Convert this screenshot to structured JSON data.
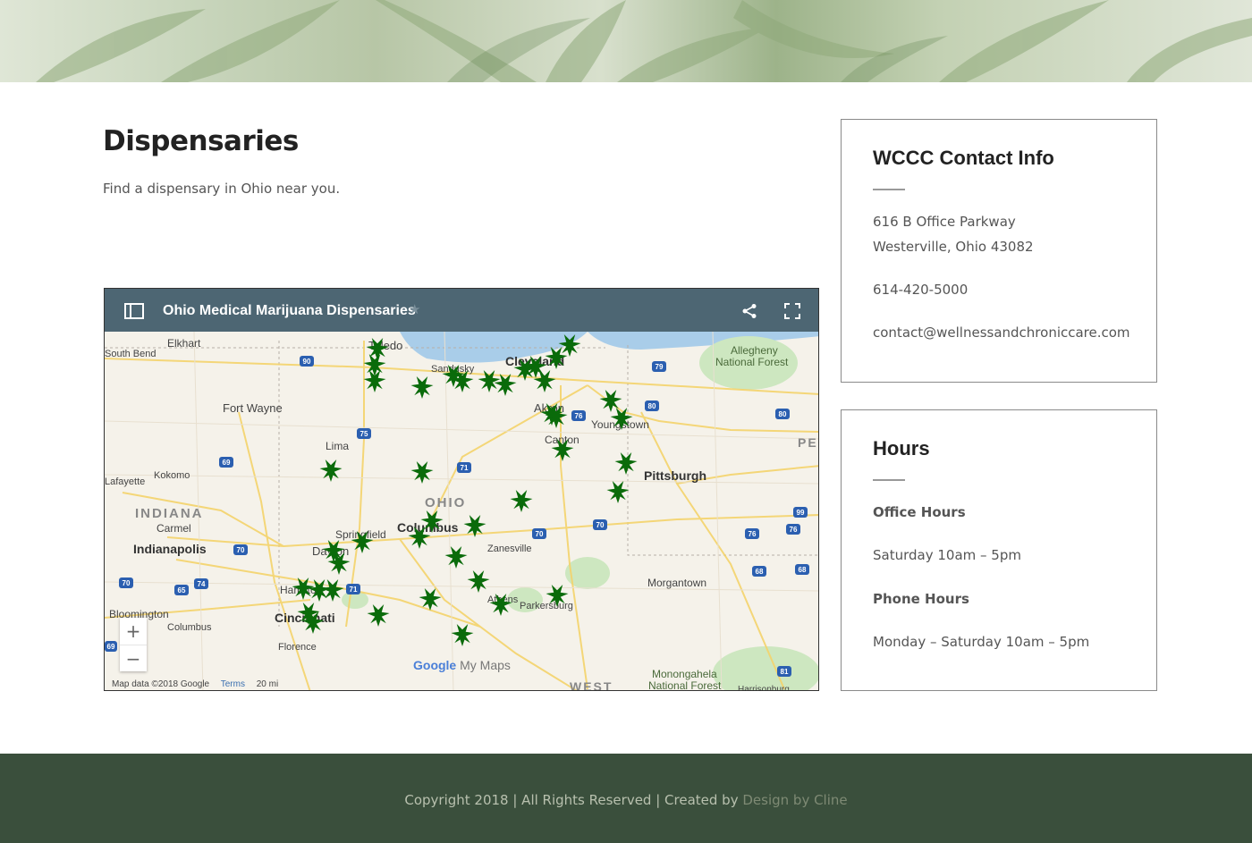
{
  "page": {
    "title": "Dispensaries",
    "intro": "Find a dispensary in Ohio near you."
  },
  "map": {
    "title": "Ohio Medical Marijuana Dispensaries",
    "icons": {
      "panel": "sidebar-toggle-icon",
      "star": "star-icon",
      "share": "share-icon",
      "fullscreen": "fullscreen-icon"
    },
    "zoom_in": "+",
    "zoom_out": "−",
    "attribution": "Map data ©2018 Google",
    "terms": "Terms",
    "scale": "20 mi",
    "logo_google": "Google",
    "logo_mymaps": "My Maps",
    "labels": [
      "Elkhart",
      "South Bend",
      "Toledo",
      "Sandusky",
      "Cleveland",
      "Fort Wayne",
      "Akron",
      "Youngstown",
      "Canton",
      "Lima",
      "Kokomo",
      "Lafayette",
      "INDIANA",
      "OHIO",
      "Pittsburgh",
      "Carmel",
      "Indianapolis",
      "Springfield",
      "Columbus",
      "Zanesville",
      "Dayton",
      "Hamilton",
      "Cincinnati",
      "Bloomington",
      "Columbus",
      "Florence",
      "Athens",
      "Parkersburg",
      "Morgantown",
      "Allegheny National Forest",
      "Monongahela National Forest",
      "WEST",
      "PE",
      "Harrisonburg"
    ],
    "marker_color": "#0a6b0a"
  },
  "contact": {
    "title": "WCCC Contact Info",
    "address1": "616 B Office Parkway",
    "address2": "Westerville, Ohio 43082",
    "phone": "614-420-5000",
    "email": "contact@wellnessandchroniccare.com"
  },
  "hours": {
    "title": "Hours",
    "office_label": "Office Hours",
    "office_hours": "Saturday 10am – 5pm",
    "phone_label": "Phone Hours",
    "phone_hours": "Monday – Saturday 10am – 5pm"
  },
  "footer": {
    "copyright": "Copyright 2018 | All Rights Reserved | Created by",
    "credit": "Design by Cline"
  }
}
